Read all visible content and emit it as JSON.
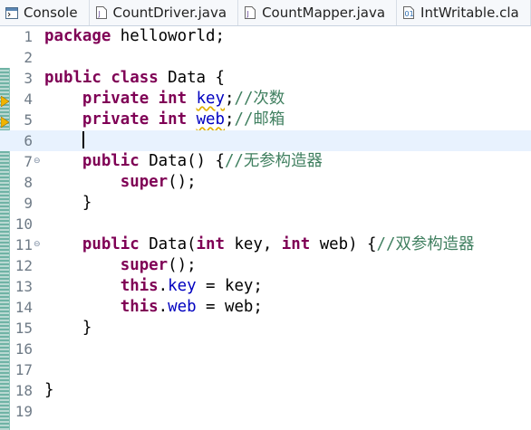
{
  "tabs": [
    {
      "label": "Console",
      "icon": "console-icon"
    },
    {
      "label": "CountDriver.java",
      "icon": "java-file-icon"
    },
    {
      "label": "CountMapper.java",
      "icon": "java-file-icon"
    },
    {
      "label": "IntWritable.cla",
      "icon": "class-file-icon"
    }
  ],
  "lines": [
    {
      "n": "1"
    },
    {
      "n": "2"
    },
    {
      "n": "3"
    },
    {
      "n": "4"
    },
    {
      "n": "5"
    },
    {
      "n": "6"
    },
    {
      "n": "7"
    },
    {
      "n": "8"
    },
    {
      "n": "9"
    },
    {
      "n": "10"
    },
    {
      "n": "11"
    },
    {
      "n": "12"
    },
    {
      "n": "13"
    },
    {
      "n": "14"
    },
    {
      "n": "15"
    },
    {
      "n": "16"
    },
    {
      "n": "17"
    },
    {
      "n": "18"
    },
    {
      "n": "19"
    }
  ],
  "code": {
    "l1": {
      "kw": "package",
      "rest": " helloworld;"
    },
    "l3": {
      "kw1": "public",
      "kw2": "class",
      "rest": " Data {"
    },
    "l4": {
      "kw1": "private",
      "kw2": "int",
      "field": "key",
      "semi": ";",
      "comment": "//次数"
    },
    "l5": {
      "kw1": "private",
      "kw2": "int",
      "field": "web",
      "semi": ";",
      "comment": "//邮箱"
    },
    "l7": {
      "kw": "public",
      "rest": " Data() {",
      "comment": "//无参构造器"
    },
    "l8": {
      "kw": "super",
      "rest": "();"
    },
    "l9": {
      "rest": "}"
    },
    "l11": {
      "kw1": "public",
      "mid1": " Data(",
      "kw2": "int",
      "mid2": " key, ",
      "kw3": "int",
      "mid3": " web) {",
      "comment": "//双参构造器"
    },
    "l12": {
      "kw": "super",
      "rest": "();"
    },
    "l13": {
      "kw": "this",
      "dot": ".",
      "field": "key",
      "rest": " = key;"
    },
    "l14": {
      "kw": "this",
      "dot": ".",
      "field": "web",
      "rest": " = web;"
    },
    "l15": {
      "rest": "}"
    },
    "l18": {
      "rest": "}"
    }
  },
  "colors": {
    "keyword": "#7f0055",
    "field": "#0000c0",
    "comment": "#3f7f5f",
    "line_number": "#6f7b87",
    "current_line": "#e8f2fe"
  }
}
